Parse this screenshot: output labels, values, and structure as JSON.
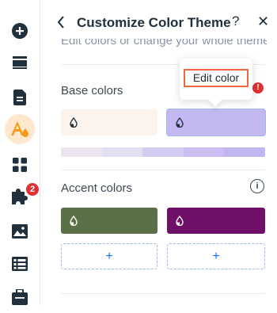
{
  "header": {
    "title": "Customize Color Theme",
    "help_label": "?",
    "close_label": "✕"
  },
  "subtitle": "Edit colors or change your whole theme.",
  "sections": {
    "base": {
      "label": "Base colors"
    },
    "accent": {
      "label": "Accent colors",
      "info_label": "i"
    }
  },
  "tooltip": {
    "edit_label": "Edit color"
  },
  "error_badge": "!",
  "rail": {
    "items": [
      {
        "icon": "add-icon"
      },
      {
        "icon": "sections-icon"
      },
      {
        "icon": "pages-icon"
      },
      {
        "icon": "design-icon",
        "active": true
      },
      {
        "icon": "apps-icon"
      },
      {
        "icon": "add-apps-icon",
        "badge": "2"
      },
      {
        "icon": "media-icon"
      },
      {
        "icon": "cms-icon"
      },
      {
        "icon": "business-icon"
      }
    ]
  },
  "colors": {
    "base_1": "#fcf4ec",
    "base_2": "#c4b8f0",
    "accent_1": "#5a7046",
    "accent_2": "#6f0f68",
    "palette": [
      "#ece5ef",
      "#e4dff0",
      "#d4cbf2",
      "#c9bdf1",
      "#c2b6ef"
    ],
    "active_bg": "#fde7cd",
    "active_icon": "#f79b1c",
    "add_plus": "+"
  }
}
